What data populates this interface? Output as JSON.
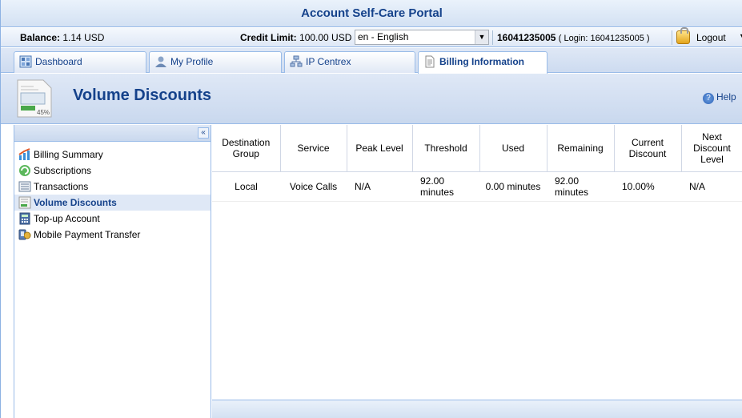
{
  "portal": {
    "title": "Account Self-Care Portal"
  },
  "info": {
    "balance_label": "Balance:",
    "balance_value": "1.14 USD",
    "credit_label": "Credit Limit:",
    "credit_value": "100.00 USD",
    "language": "en - English",
    "account_id": "16041235005",
    "login_text": "( Login: 16041235005 )",
    "logout_label": "Logout"
  },
  "tabs": [
    {
      "label": "Dashboard",
      "icon": "dashboard-icon"
    },
    {
      "label": "My Profile",
      "icon": "user-icon"
    },
    {
      "label": "IP Centrex",
      "icon": "network-icon"
    },
    {
      "label": "Billing Information",
      "icon": "document-icon",
      "active": true
    }
  ],
  "page": {
    "title": "Volume Discounts",
    "help_label": "Help",
    "icon_text": "45%"
  },
  "sidebar": {
    "items": [
      {
        "label": "Billing Summary",
        "icon": "chart-icon"
      },
      {
        "label": "Subscriptions",
        "icon": "refresh-icon"
      },
      {
        "label": "Transactions",
        "icon": "list-icon"
      },
      {
        "label": "Volume Discounts",
        "icon": "discount-icon",
        "selected": true
      },
      {
        "label": "Top-up Account",
        "icon": "calculator-icon"
      },
      {
        "label": "Mobile Payment Transfer",
        "icon": "payment-icon"
      }
    ]
  },
  "table": {
    "columns": [
      "Destination Group",
      "Service",
      "Peak Level",
      "Threshold",
      "Used",
      "Remaining",
      "Current Discount",
      "Next Discount Level"
    ],
    "rows": [
      [
        "Local",
        "Voice Calls",
        "N/A",
        "92.00 minutes",
        "0.00 minutes",
        "92.00 minutes",
        "10.00%",
        "N/A"
      ]
    ]
  },
  "colors": {
    "accent": "#15428b",
    "border": "#99bbe8",
    "header_bg": "#dfe8f6"
  }
}
